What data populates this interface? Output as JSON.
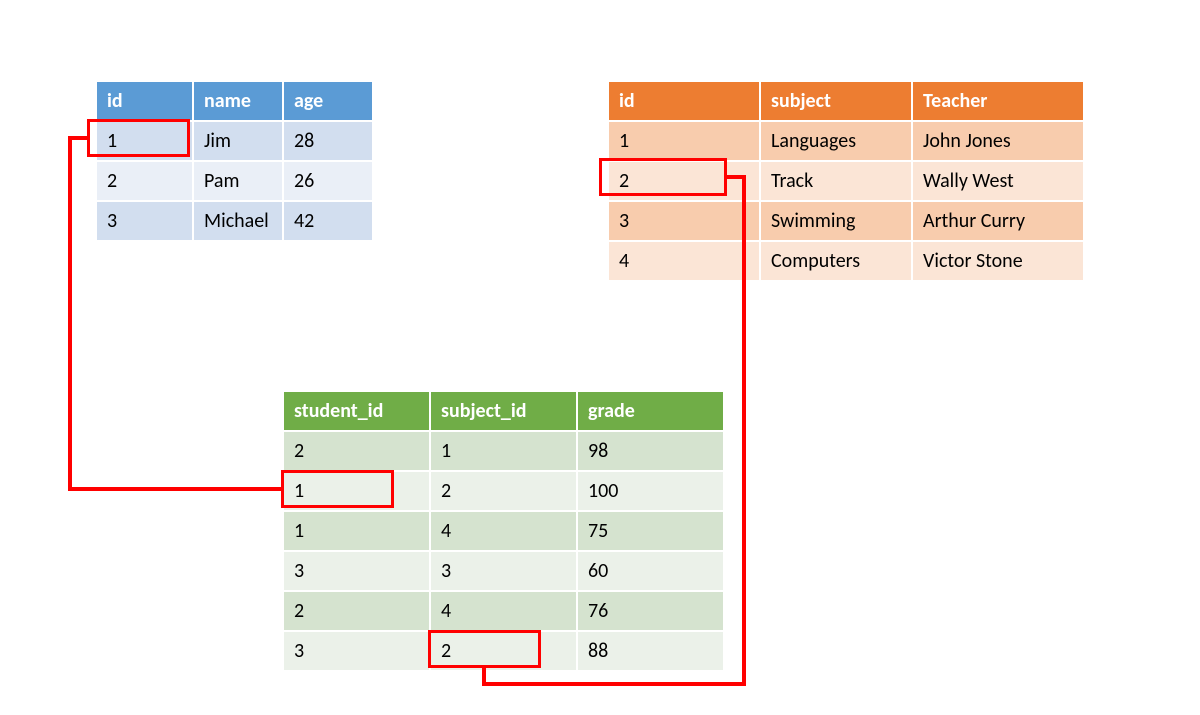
{
  "students_table": {
    "headers": {
      "id": "id",
      "name": "name",
      "age": "age"
    },
    "rows": [
      {
        "id": "1",
        "name": "Jim",
        "age": "28"
      },
      {
        "id": "2",
        "name": "Pam",
        "age": "26"
      },
      {
        "id": "3",
        "name": "Michael",
        "age": "42"
      }
    ]
  },
  "subjects_table": {
    "headers": {
      "id": "id",
      "subject": "subject",
      "teacher": "Teacher"
    },
    "rows": [
      {
        "id": "1",
        "subject": "Languages",
        "teacher": "John Jones"
      },
      {
        "id": "2",
        "subject": "Track",
        "teacher": "Wally West"
      },
      {
        "id": "3",
        "subject": "Swimming",
        "teacher": "Arthur Curry"
      },
      {
        "id": "4",
        "subject": "Computers",
        "teacher": "Victor Stone"
      }
    ]
  },
  "grades_table": {
    "headers": {
      "student_id": "student_id",
      "subject_id": "subject_id",
      "grade": "grade"
    },
    "rows": [
      {
        "student_id": "2",
        "subject_id": "1",
        "grade": "98"
      },
      {
        "student_id": "1",
        "subject_id": "2",
        "grade": "100"
      },
      {
        "student_id": "1",
        "subject_id": "4",
        "grade": "75"
      },
      {
        "student_id": "3",
        "subject_id": "3",
        "grade": "60"
      },
      {
        "student_id": "2",
        "subject_id": "4",
        "grade": "76"
      },
      {
        "student_id": "3",
        "subject_id": "2",
        "grade": "88"
      }
    ]
  },
  "highlights": {
    "student_id_1": {
      "table": "students",
      "cell": "id=1"
    },
    "subject_id_2": {
      "table": "subjects",
      "cell": "id=2"
    },
    "grade_student_1": {
      "table": "grades",
      "row_index": 1,
      "cell": "student_id=1"
    },
    "grade_subject_2": {
      "table": "grades",
      "row_index": 5,
      "cell": "subject_id=2"
    }
  },
  "colors": {
    "students_header": "#5b9bd5",
    "subjects_header": "#ed7d31",
    "grades_header": "#70ad47",
    "highlight": "#ff0000"
  }
}
